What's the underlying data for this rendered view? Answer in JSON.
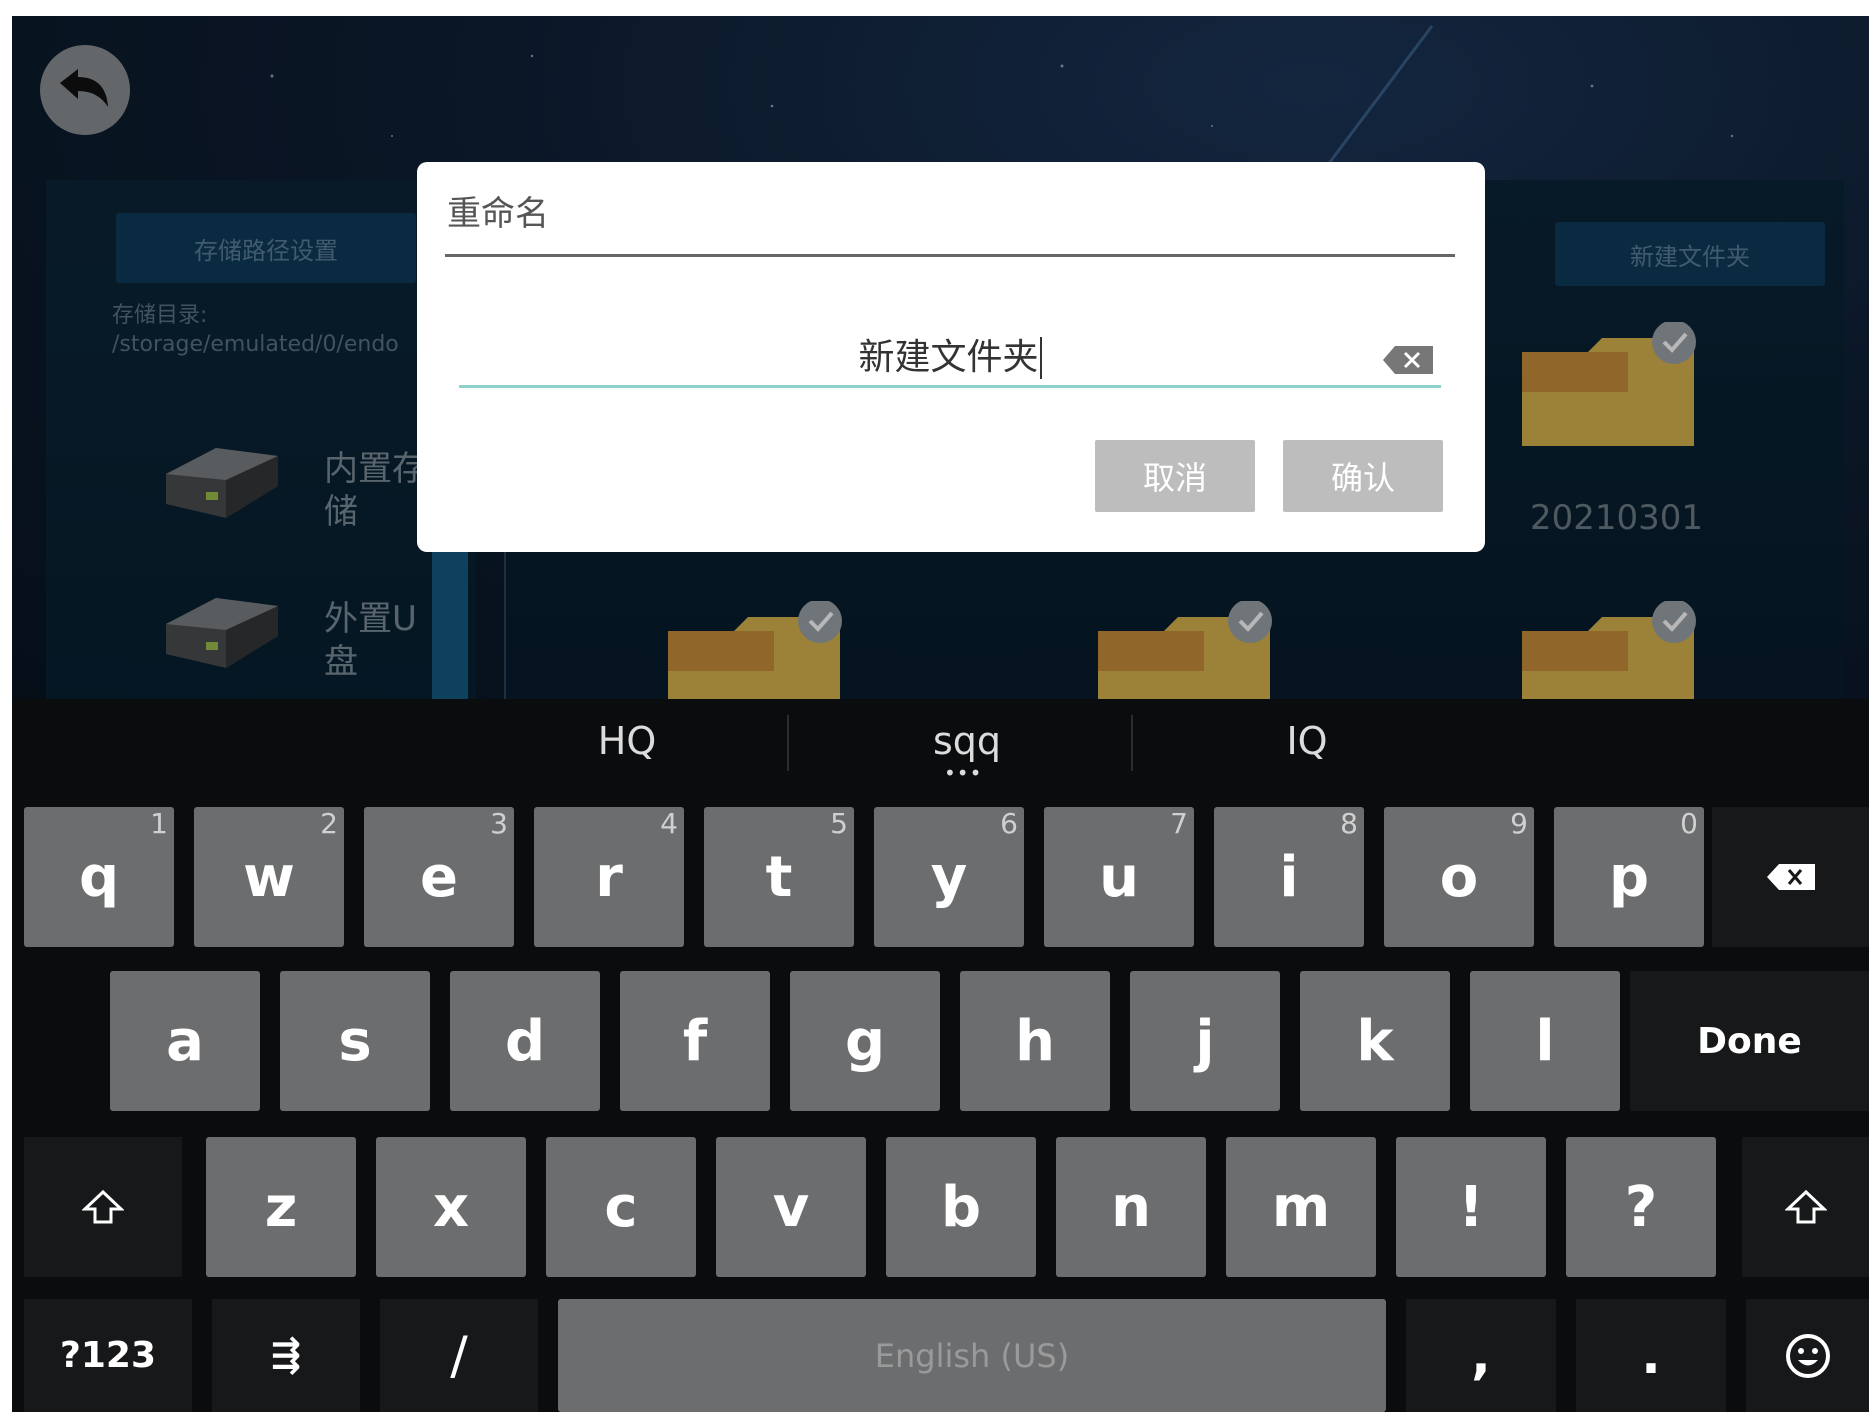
{
  "app": {
    "path_settings_label": "存储路径设置",
    "storage_dir_label": "存储目录:",
    "storage_dir_value": "/storage/emulated/0/endo",
    "drives": [
      {
        "label": "内置存\n储",
        "icon": "hard-drive-icon"
      },
      {
        "label": "外置U\n盘",
        "icon": "hard-drive-icon"
      }
    ],
    "new_folder_label": "新建文件夹",
    "folders": [
      {
        "name": "20210301",
        "checked": true
      },
      {
        "name": "",
        "checked": true
      },
      {
        "name": "",
        "checked": true
      },
      {
        "name": "",
        "checked": true
      }
    ]
  },
  "dialog": {
    "title": "重命名",
    "input_value": "新建文件夹",
    "cancel_label": "取消",
    "confirm_label": "确认"
  },
  "keyboard": {
    "suggestions": [
      "HQ",
      "sqq",
      "IQ"
    ],
    "row1": [
      {
        "k": "q",
        "h": "1"
      },
      {
        "k": "w",
        "h": "2"
      },
      {
        "k": "e",
        "h": "3"
      },
      {
        "k": "r",
        "h": "4"
      },
      {
        "k": "t",
        "h": "5"
      },
      {
        "k": "y",
        "h": "6"
      },
      {
        "k": "u",
        "h": "7"
      },
      {
        "k": "i",
        "h": "8"
      },
      {
        "k": "o",
        "h": "9"
      },
      {
        "k": "p",
        "h": "0"
      }
    ],
    "row2": [
      "a",
      "s",
      "d",
      "f",
      "g",
      "h",
      "j",
      "k",
      "l"
    ],
    "row3": [
      "z",
      "x",
      "c",
      "v",
      "b",
      "n",
      "m",
      "!",
      "?"
    ],
    "done_label": "Done",
    "symbols_label": "?123",
    "settings_glyph": "⇶",
    "slash_label": "/",
    "space_label": "English (US)",
    "comma_label": ",",
    "period_label": "."
  },
  "colors": {
    "dialog_button": "#bdbdbd",
    "input_underline": "#8fd0cb",
    "folder": "#d8b44e",
    "key": "#6c6d6f"
  }
}
